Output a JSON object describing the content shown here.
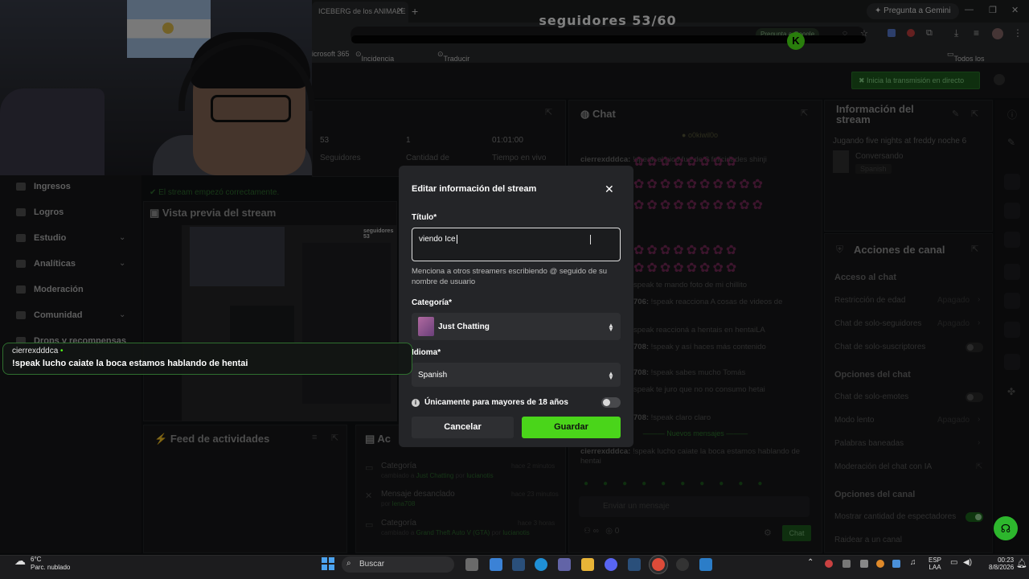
{
  "browser": {
    "tab_title": "ICEBERG de los ANIMALE",
    "gemini_label": "Pregunta a Gemini",
    "url_chip": "Pregunta a Google",
    "bookmarks": [
      "icrosoft 365",
      "Incidencia Dominio...",
      "Traducir"
    ],
    "all_bookmarks": "Todos los marcadores"
  },
  "overlay": {
    "followers_title": "seguidores 53/60",
    "followers_current": 53,
    "followers_goal": 60
  },
  "header": {
    "go_live": "Inicia la transmisión en directo"
  },
  "sidebar": {
    "items": [
      {
        "label": "Ingresos",
        "chevron": false
      },
      {
        "label": "Logros",
        "chevron": false
      },
      {
        "label": "Estudio",
        "chevron": true
      },
      {
        "label": "Analíticas",
        "chevron": true
      },
      {
        "label": "Moderación",
        "chevron": false
      },
      {
        "label": "Comunidad",
        "chevron": true
      },
      {
        "label": "Drops y recompensas",
        "chevron": false
      }
    ]
  },
  "stats": {
    "followers_value": "53",
    "followers_label": "Seguidores",
    "qty_value": "1",
    "qty_label": "Cantidad de",
    "time_value": "01:01:00",
    "time_label": "Tiempo en vivo",
    "stream_ok": "El stream empezó correctamente."
  },
  "preview": {
    "title": "Vista previa del stream",
    "inner_title": "seguidores 53"
  },
  "feed": {
    "title": "Feed de actividades"
  },
  "activity": {
    "title": "Ac",
    "items": [
      {
        "title": "Categoría",
        "sub_prefix": "cambiado a",
        "sub_value": "Just Chatting",
        "sub_mid": "por",
        "sub_user": "lucianotis",
        "time": "hace 2 minutos"
      },
      {
        "title": "Mensaje desanclado",
        "sub_prefix": "por",
        "sub_value": "lena708",
        "sub_mid": "",
        "sub_user": "",
        "time": "hace 23 minutos"
      },
      {
        "title": "Categoría",
        "sub_prefix": "cambiado a",
        "sub_value": "Grand Theft Auto V (GTA)",
        "sub_mid": "por",
        "sub_user": "lucianotis",
        "time": "hace 3 horas"
      }
    ]
  },
  "chat": {
    "title": "Chat",
    "pinned_user": "o0kiwil0o",
    "messages": [
      {
        "user": "cierrexdddca:",
        "text": "!speak el pico fue de 8 felicidades shinji"
      },
      {
        "user": "",
        "text": "speak te mando foto de mi chillito"
      },
      {
        "user": "706:",
        "text": "!speak reacciona A cosas de videos de"
      },
      {
        "user": "",
        "text": "speak reaccioná a hentais en hentaiLA"
      },
      {
        "user": "708:",
        "text": "!speak y así haces más contenido"
      },
      {
        "user": "708:",
        "text": "!speak sabes mucho Tomás"
      },
      {
        "user": "",
        "text": "speak te juro que no no consumo hetai"
      },
      {
        "user": "708:",
        "text": "!speak claro claro"
      }
    ],
    "new_messages": "Nuevos mensajes",
    "last_user": "cierrexdddca:",
    "last_text": "!speak lucho caiate la boca estamos hablando de hentai",
    "input_placeholder": "Enviar un mensaje",
    "count_a": "∞",
    "count_b": "0",
    "send_label": "Chat"
  },
  "info": {
    "title": "Información del stream",
    "stream_title": "Jugando five nights at freddy noche 6",
    "category": "Conversando",
    "language": "Spanish"
  },
  "actions": {
    "title": "Acciones de canal",
    "sections": [
      {
        "header": "Acceso al chat"
      },
      {
        "header": "Opciones del chat"
      },
      {
        "header": "Opciones del canal"
      }
    ],
    "rows": [
      {
        "label": "Restricción de edad",
        "value": "Apagado",
        "type": "chevron"
      },
      {
        "label": "Chat de solo-seguidores",
        "value": "Apagado",
        "type": "chevron"
      },
      {
        "label": "Chat de solo-suscriptores",
        "value": "",
        "type": "toggle-off"
      },
      {
        "label": "Chat de solo-emotes",
        "value": "",
        "type": "toggle-off"
      },
      {
        "label": "Modo lento",
        "value": "Apagado",
        "type": "chevron"
      },
      {
        "label": "Palabras baneadas",
        "value": "",
        "type": "chevron"
      },
      {
        "label": "Moderación del chat con IA",
        "value": "",
        "type": "external"
      },
      {
        "label": "Mostrar cantidad de espectadores",
        "value": "",
        "type": "toggle-on"
      },
      {
        "label": "Raidear a un canal",
        "value": "",
        "type": "none"
      }
    ]
  },
  "toast": {
    "user": "cierrexdddca",
    "message": "!speak lucho caiate la boca estamos hablando de hentai"
  },
  "modal": {
    "title": "Editar información del stream",
    "title_label": "Título*",
    "title_value": "viendo Ice",
    "hint": "Menciona a otros streamers escribiendo @ seguido de su nombre de usuario",
    "category_label": "Categoría*",
    "category_value": "Just Chatting",
    "language_label": "Idioma*",
    "language_value": "Spanish",
    "adult_label": "Únicamente para mayores de 18 años",
    "adult_enabled": false,
    "cancel": "Cancelar",
    "save": "Guardar"
  },
  "taskbar": {
    "temp": "6°C",
    "weather": "Parc. nublado",
    "search": "Buscar",
    "lang_top": "ESP",
    "lang_bottom": "LAA",
    "time": "00:23",
    "date": "8/8/2026"
  },
  "colors": {
    "kick_green": "#53fc18",
    "panel_bg": "#18191b",
    "modal_bg": "#242528"
  }
}
